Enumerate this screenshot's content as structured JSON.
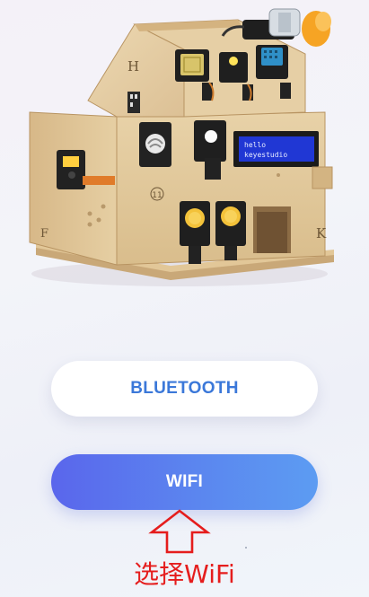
{
  "hero": {
    "image_name": "smart-home-kit-image",
    "letter_h": "H",
    "letter_f": "F",
    "letter_k": "K",
    "number_badge": "11",
    "lcd_line1": "hello",
    "lcd_line2": "keyestudio"
  },
  "buttons": {
    "bluetooth_label": "BLUETOOTH",
    "wifi_label": "WIFI"
  },
  "annotation": {
    "label": "选择WiFi",
    "color": "#e51d1d"
  },
  "colors": {
    "bluetooth_text": "#3b78d9",
    "wifi_gradient_start": "#5a66ec",
    "wifi_gradient_end": "#5c9cf2"
  }
}
